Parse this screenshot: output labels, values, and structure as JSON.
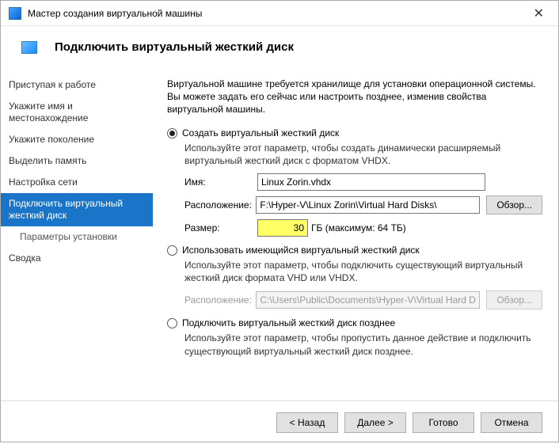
{
  "window": {
    "title": "Мастер создания виртуальной машины"
  },
  "header": {
    "title": "Подключить виртуальный жесткий диск"
  },
  "sidebar": {
    "items": [
      {
        "label": "Приступая к работе"
      },
      {
        "label": "Укажите имя и местонахождение"
      },
      {
        "label": "Укажите поколение"
      },
      {
        "label": "Выделить память"
      },
      {
        "label": "Настройка сети"
      },
      {
        "label": "Подключить виртуальный жесткий диск"
      },
      {
        "label": "Параметры установки"
      },
      {
        "label": "Сводка"
      }
    ]
  },
  "content": {
    "intro": "Виртуальной машине требуется хранилище для установки операционной системы. Вы можете задать его сейчас или настроить позднее, изменив свойства виртуальной машины.",
    "opt_create": {
      "title": "Создать виртуальный жесткий диск",
      "desc": "Используйте этот параметр, чтобы создать динамически расширяемый виртуальный жесткий диск с форматом VHDX.",
      "name_label": "Имя:",
      "name_value": "Linux Zorin.vhdx",
      "loc_label": "Расположение:",
      "loc_value": "F:\\Hyper-V\\Linux Zorin\\Virtual Hard Disks\\",
      "browse_label": "Обзор...",
      "size_label": "Размер:",
      "size_value": "30",
      "size_unit": "ГБ (максимум: 64 ТБ)"
    },
    "opt_existing": {
      "title": "Использовать имеющийся виртуальный жесткий диск",
      "desc": "Используйте этот параметр, чтобы подключить существующий виртуальный жесткий диск формата VHD или VHDX.",
      "loc_label": "Расположение:",
      "loc_value": "C:\\Users\\Public\\Documents\\Hyper-V\\Virtual Hard Disks\\",
      "browse_label": "Обзор..."
    },
    "opt_later": {
      "title": "Подключить виртуальный жесткий диск позднее",
      "desc": "Используйте этот параметр, чтобы пропустить данное действие и подключить существующий виртуальный жесткий диск позднее."
    }
  },
  "footer": {
    "back": "< Назад",
    "next": "Далее >",
    "finish": "Готово",
    "cancel": "Отмена"
  }
}
